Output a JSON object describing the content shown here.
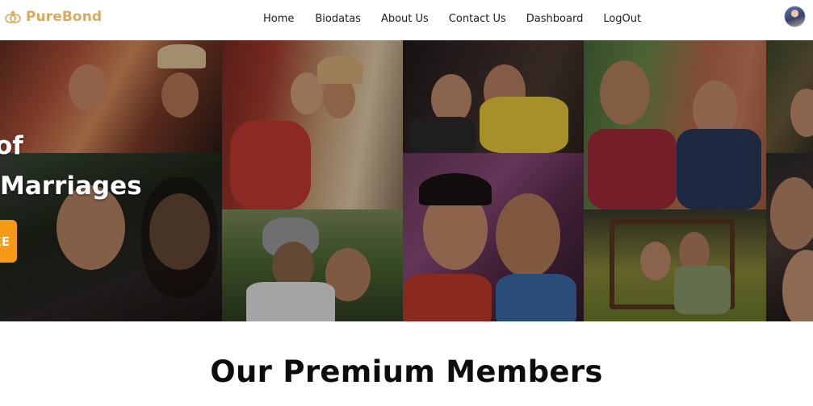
{
  "brand": {
    "name": "PureBond",
    "icon": "rings-logo-icon",
    "color": "#d9a95c"
  },
  "nav": {
    "links": [
      {
        "label": "Home"
      },
      {
        "label": "Biodatas"
      },
      {
        "label": "About Us"
      },
      {
        "label": "Contact Us"
      },
      {
        "label": "Dashboard"
      },
      {
        "label": "LogOut"
      }
    ],
    "avatar_icon": "user-avatar-icon"
  },
  "hero": {
    "line1": "of",
    "line2": "Marriages",
    "cta_label": "EE",
    "cta_color": "#f59a15"
  },
  "sections": {
    "premium_title": "Our Premium Members"
  }
}
